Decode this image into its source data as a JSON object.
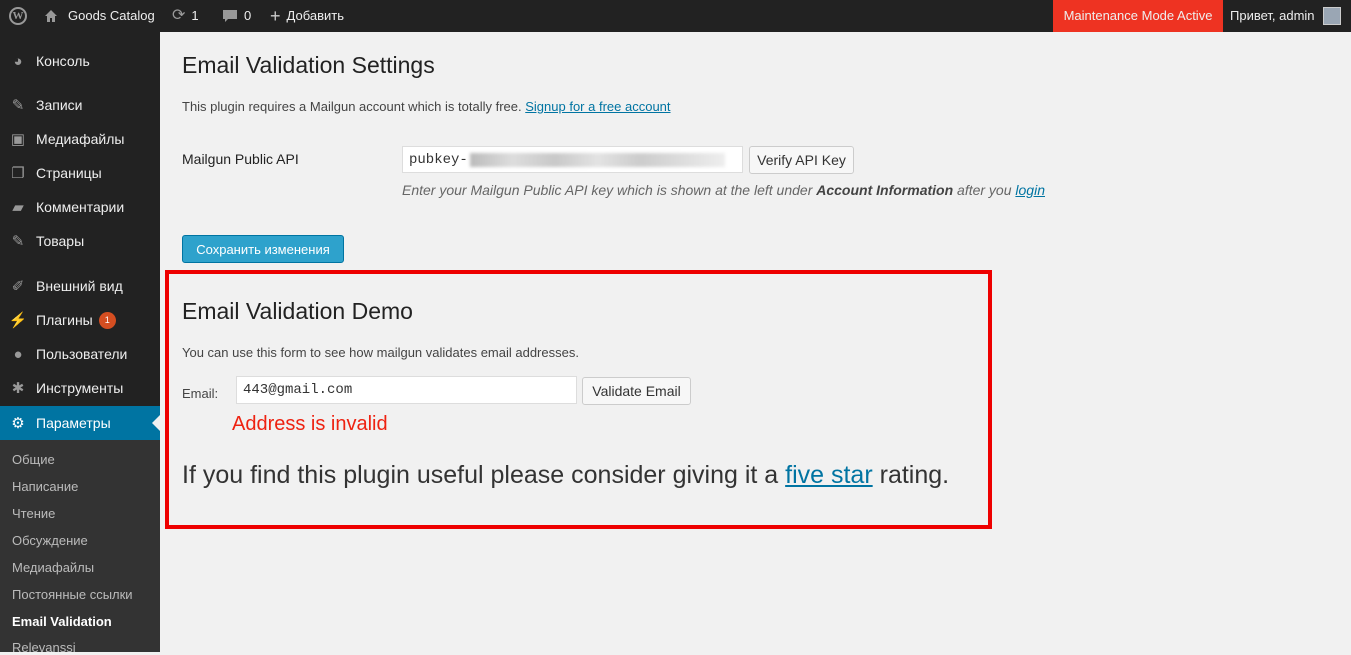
{
  "adminbar": {
    "site_name": "Goods Catalog",
    "updates_count": "1",
    "comments_count": "0",
    "new_label": "Добавить",
    "maintenance_label": "Maintenance Mode Active",
    "greeting": "Привет, admin"
  },
  "sidebar": {
    "items": [
      {
        "label": "Консоль",
        "icon": "dashboard-icon"
      },
      {
        "label": "Записи",
        "icon": "pin-icon"
      },
      {
        "label": "Медиафайлы",
        "icon": "media-icon"
      },
      {
        "label": "Страницы",
        "icon": "pages-icon"
      },
      {
        "label": "Комментарии",
        "icon": "comments-icon"
      },
      {
        "label": "Товары",
        "icon": "pin-icon"
      },
      {
        "label": "Внешний вид",
        "icon": "brush-icon"
      },
      {
        "label": "Плагины",
        "icon": "plugin-icon",
        "badge": "1"
      },
      {
        "label": "Пользователи",
        "icon": "user-icon"
      },
      {
        "label": "Инструменты",
        "icon": "wrench-icon"
      },
      {
        "label": "Параметры",
        "icon": "settings-icon"
      }
    ],
    "submenu": [
      "Общие",
      "Написание",
      "Чтение",
      "Обсуждение",
      "Медиафайлы",
      "Постоянные ссылки",
      "Email Validation",
      "Relevanssi"
    ]
  },
  "settings": {
    "title": "Email Validation Settings",
    "intro": "This plugin requires a Mailgun account which is totally free.",
    "signup_link": "Signup for a free account",
    "api_label": "Mailgun Public API",
    "api_value_prefix": "pubkey-",
    "verify_button": "Verify API Key",
    "hint_part1": "Enter your Mailgun Public API key which is shown at the left under ",
    "hint_bold": "Account Information",
    "hint_part2": " after you ",
    "hint_link": "login",
    "save_button": "Сохранить изменения"
  },
  "demo": {
    "title": "Email Validation Demo",
    "description": "You can use this form to see how mailgun validates email addresses.",
    "email_label": "Email:",
    "email_value": "443@gmail.com",
    "validate_button": "Validate Email",
    "result_message": "Address is invalid",
    "rating_part1": "If you find this plugin useful please consider giving it a ",
    "rating_link": "five star",
    "rating_part2": " rating."
  },
  "colors": {
    "accent": "#0074a2",
    "maintenance": "#ee3322",
    "error": "#ee2211",
    "highlight_border": "#ee0000"
  }
}
